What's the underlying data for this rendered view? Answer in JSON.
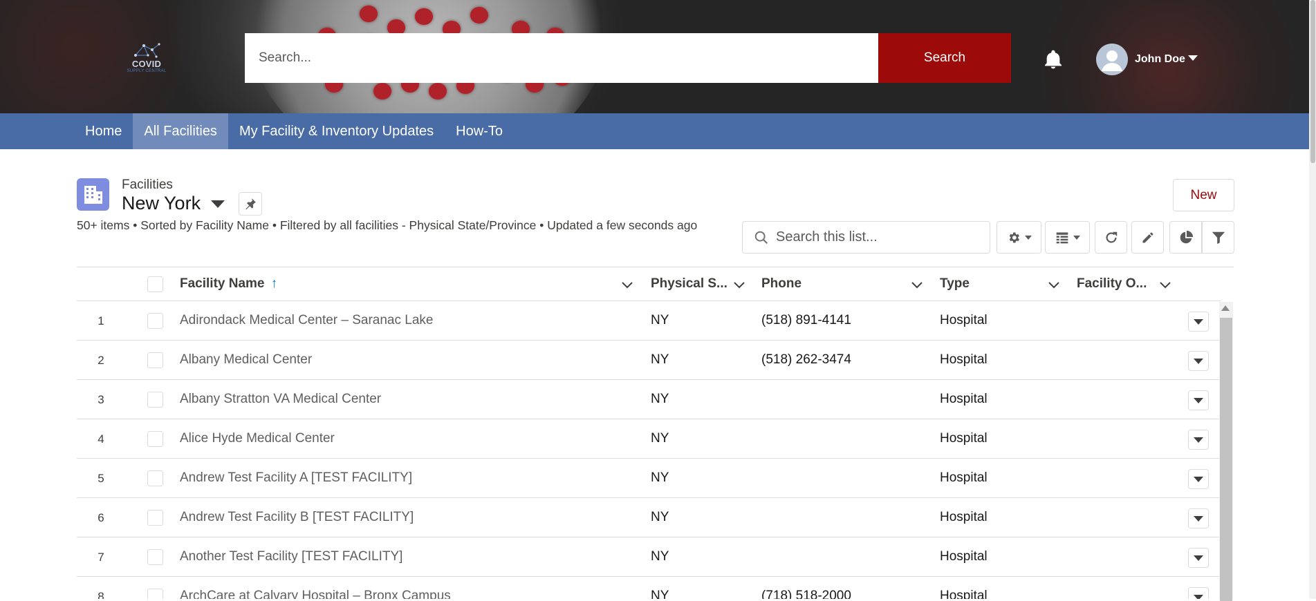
{
  "header": {
    "logo_title": "COVID",
    "logo_subtitle": "SUPPLY CENTRAL",
    "search_placeholder": "Search...",
    "search_button": "Search",
    "user_name": "John Doe",
    "icons": [
      "bell-icon",
      "avatar-icon",
      "chevron-down-icon"
    ]
  },
  "nav": {
    "items": [
      {
        "label": "Home",
        "active": false
      },
      {
        "label": "All Facilities",
        "active": true
      },
      {
        "label": "My Facility & Inventory Updates",
        "active": false
      },
      {
        "label": "How-To",
        "active": false
      }
    ]
  },
  "list": {
    "object_type": "Facilities",
    "name": "New York",
    "info": "50+ items • Sorted by Facility Name • Filtered by all facilities - Physical State/Province • Updated a few seconds ago",
    "new_button": "New",
    "search_placeholder": "Search this list...",
    "toolbar_icons": [
      "gear-icon",
      "table-view-icon",
      "refresh-icon",
      "pencil-icon",
      "pie-chart-icon",
      "filter-icon"
    ]
  },
  "table": {
    "columns": [
      "Facility Name",
      "Physical S...",
      "Phone",
      "Type",
      "Facility O..."
    ],
    "sort_indicator": "↑",
    "rows": [
      {
        "num": "1",
        "name": "Adirondack Medical Center – Saranac Lake",
        "state": "NY",
        "phone": "(518) 891-4141",
        "type": "Hospital"
      },
      {
        "num": "2",
        "name": "Albany Medical Center",
        "state": "NY",
        "phone": "(518) 262-3474",
        "type": "Hospital"
      },
      {
        "num": "3",
        "name": "Albany Stratton VA Medical Center",
        "state": "NY",
        "phone": "",
        "type": "Hospital"
      },
      {
        "num": "4",
        "name": "Alice Hyde Medical Center",
        "state": "NY",
        "phone": "",
        "type": "Hospital"
      },
      {
        "num": "5",
        "name": "Andrew Test Facility A [TEST FACILITY]",
        "state": "NY",
        "phone": "",
        "type": "Hospital"
      },
      {
        "num": "6",
        "name": "Andrew Test Facility B [TEST FACILITY]",
        "state": "NY",
        "phone": "",
        "type": "Hospital"
      },
      {
        "num": "7",
        "name": "Another Test Facility [TEST FACILITY]",
        "state": "NY",
        "phone": "",
        "type": "Hospital"
      },
      {
        "num": "8",
        "name": "ArchCare at Calvary Hospital – Bronx Campus",
        "state": "NY",
        "phone": "(718) 518-2000",
        "type": "Hospital"
      }
    ]
  }
}
